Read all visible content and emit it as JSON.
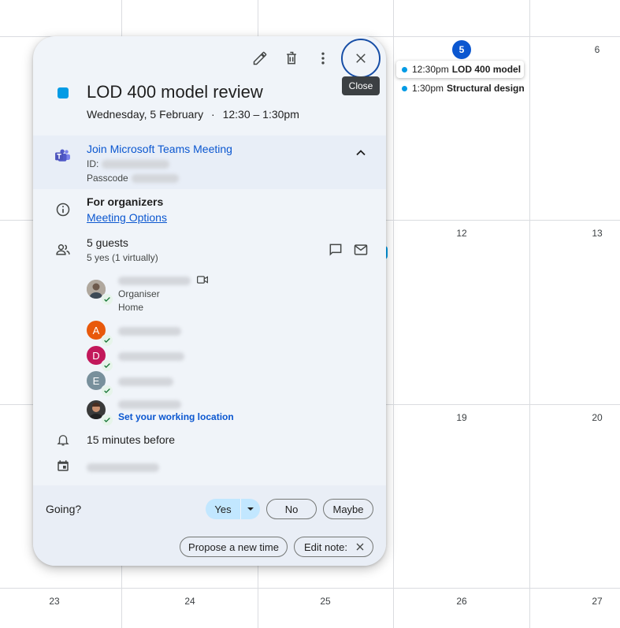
{
  "calendar": {
    "row1": [
      "5",
      "6"
    ],
    "row2": [
      "12",
      "13"
    ],
    "row3": [
      "19",
      "20"
    ],
    "row4": [
      "23",
      "24",
      "25",
      "26",
      "27"
    ],
    "events": [
      {
        "time": "12:30pm",
        "title": "LOD 400 model"
      },
      {
        "time": "1:30pm",
        "title": "Structural design"
      }
    ]
  },
  "popup": {
    "tooltip": "Close",
    "title": "LOD 400 model review",
    "date": "Wednesday, 5 February",
    "separator": "·",
    "time_range": "12:30 – 1:30pm",
    "teams": {
      "link": "Join Microsoft Teams Meeting",
      "id_label": "ID:",
      "passcode_label": "Passcode"
    },
    "organizers": {
      "heading": "For organizers",
      "link": "Meeting Options"
    },
    "guests": {
      "count": "5 guests",
      "summary": "5 yes (1 virtually)",
      "organiser_role": "Organiser",
      "organiser_location": "Home",
      "initials": [
        "A",
        "D",
        "E"
      ],
      "working_location_link": "Set your working location"
    },
    "reminder": "15 minutes before",
    "rsvp": {
      "label": "Going?",
      "yes": "Yes",
      "no": "No",
      "maybe": "Maybe"
    },
    "actions": {
      "propose": "Propose a new time",
      "edit_note": "Edit note:"
    }
  },
  "colors": {
    "accent": "#0b57d0",
    "event": "#039be5",
    "avatar_a": "#e8590c",
    "avatar_d": "#c2185b",
    "avatar_e": "#78909c"
  }
}
